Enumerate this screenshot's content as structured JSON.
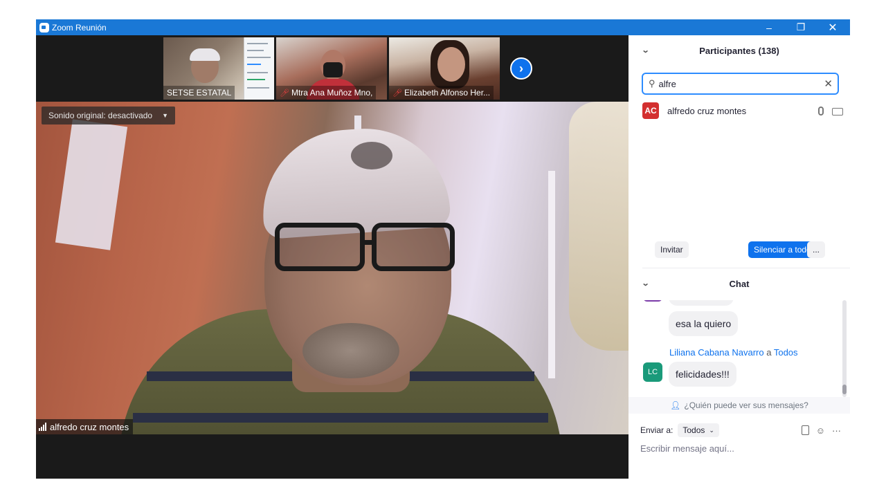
{
  "window": {
    "title": "Zoom Reunión",
    "minimize": "–",
    "maximize": "❐",
    "close": "✕"
  },
  "video": {
    "audio_option": "Sonido original: desactivado",
    "speaker_name": "alfredo cruz montes",
    "thumbnails": [
      {
        "name": "SETSE ESTATAL",
        "muted": false
      },
      {
        "name": "Mtra Ana Muñoz Mno,",
        "muted": true
      },
      {
        "name": "Elizabeth Alfonso Her...",
        "muted": true
      }
    ],
    "next_icon": "chevron-right-icon"
  },
  "participants": {
    "header": "Participantes (138)",
    "search_value": "alfre",
    "list": [
      {
        "initials": "AC",
        "name": "alfredo cruz montes",
        "avatar_color": "#d32f2f"
      }
    ],
    "invite_label": "Invitar",
    "mute_all_label": "Silenciar a todos",
    "more_label": "..."
  },
  "chat": {
    "header": "Chat",
    "messages": [
      {
        "text": "esa la quiero"
      },
      {
        "sender": "Liliana Cabana Navarro",
        "connector": "a",
        "recipient": "Todos",
        "initials": "LC",
        "text": "felicidades!!!"
      }
    ],
    "who_sees": "¿Quién puede ver sus mensajes?",
    "send_to_label": "Enviar a:",
    "send_to_value": "Todos",
    "input_placeholder": "Escribir mensaje aquí..."
  },
  "colors": {
    "titlebar": "#1a78d6",
    "accent": "#0e72ed",
    "search_border": "#2d8cff"
  }
}
